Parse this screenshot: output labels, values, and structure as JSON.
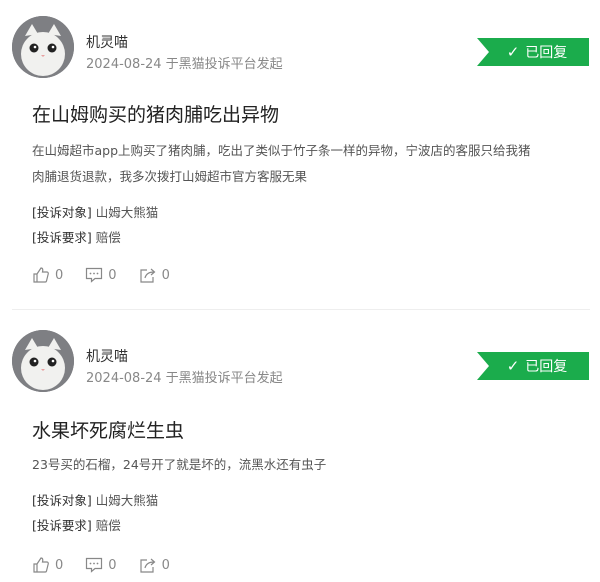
{
  "complaints": [
    {
      "user": "机灵喵",
      "meta": "2024-08-24 于黑猫投诉平台发起",
      "status": "已回复",
      "title": "在山姆购买的猪肉脯吃出异物",
      "desc_lines": [
        "在山姆超市app上购买了猪肉脯，吃出了类似于竹子条一样的异物，宁波店的客服只给我猪",
        "肉脯退货退款，我多次拨打山姆超市官方客服无果"
      ],
      "target_key": "[投诉对象]",
      "target_val": "山姆大熊猫",
      "demand_key": "[投诉要求]",
      "demand_val": "赔偿",
      "likes": "0",
      "comments": "0",
      "shares": "0"
    },
    {
      "user": "机灵喵",
      "meta": "2024-08-24 于黑猫投诉平台发起",
      "status": "已回复",
      "title": "水果坏死腐烂生虫",
      "desc_lines": [
        "23号买的石榴，24号开了就是坏的，流黑水还有虫子"
      ],
      "target_key": "[投诉对象]",
      "target_val": "山姆大熊猫",
      "demand_key": "[投诉要求]",
      "demand_val": "赔偿",
      "likes": "0",
      "comments": "0",
      "shares": "0"
    }
  ],
  "colors": {
    "badge": "#1bac4c",
    "muted": "#888888"
  },
  "icons": [
    "cat-avatar-icon",
    "check-icon",
    "thumbs-up-icon",
    "comment-icon",
    "share-icon"
  ]
}
